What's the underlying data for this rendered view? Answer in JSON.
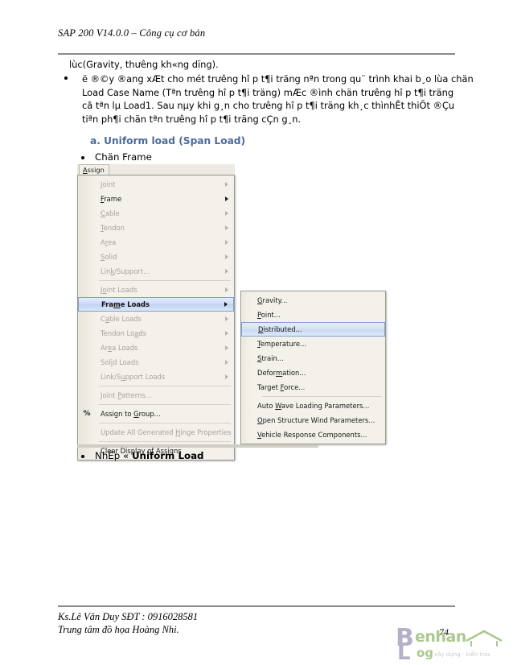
{
  "document": {
    "header_title": "SAP 200 V14.0.0 – Công cụ cơ bản",
    "lead_line": "lùc(Gravity, thưêng kh«ng dïng).",
    "paragraph": {
      "line1": "ë ®©y ®ang xÆt cho mét trưêng hî p t¶i träng nªn trong qu¨ trình khai b¸o lùa chän",
      "line2": "Load Case Name (Tªn trưêng hî p t¶i träng) mÆc ®ình chän trưêng hî p t¶i träng",
      "line3": "cã tªn lµ Load1. Sau nµy khi g¸n cho trưêng hî p t¶i träng kh¸c thìnhÊt thiÕt ®Çu",
      "line4": "tiªn ph¶i chän tªn trưêng hî p t¶i träng cÇn g¸n."
    },
    "sub_heading": "a. Uniform load (Span Load)",
    "steps": {
      "step1": "Chän Frame",
      "step2_prefix": "NhËp « ",
      "step2_bold": "Uniform Load"
    },
    "footer": {
      "line1": "Ks.Lê Văn Duy SĐT : 0916028581",
      "line2": "Trung tâm đồ họa Hoàng Nhi.",
      "page_number": "74"
    },
    "watermark": {
      "b": "B",
      "l": "L",
      "enhan": "enhan",
      "og": "og",
      "tagline": "xây dựng - kiến trúc",
      "house_icon": "house-icon"
    }
  },
  "sap_menu": {
    "menubar_item": "Assign",
    "menubar_accel": "A",
    "items": [
      {
        "label": "Joint",
        "accel": "J",
        "enabled": false,
        "submenu": true,
        "selected": false,
        "separator_after": false
      },
      {
        "label": "Frame",
        "accel": "F",
        "enabled": true,
        "submenu": true,
        "selected": false,
        "separator_after": false
      },
      {
        "label": "Cable",
        "accel": "C",
        "enabled": false,
        "submenu": true,
        "selected": false,
        "separator_after": false
      },
      {
        "label": "Tendon",
        "accel": "T",
        "enabled": false,
        "submenu": true,
        "selected": false,
        "separator_after": false
      },
      {
        "label": "Area",
        "accel": "r",
        "enabled": false,
        "submenu": true,
        "selected": false,
        "separator_after": false
      },
      {
        "label": "Solid",
        "accel": "S",
        "enabled": false,
        "submenu": true,
        "selected": false,
        "separator_after": false
      },
      {
        "label": "Link/Support...",
        "accel": "k",
        "enabled": false,
        "submenu": true,
        "selected": false,
        "separator_after": true
      },
      {
        "label": "Joint Loads",
        "accel": "o",
        "enabled": false,
        "submenu": true,
        "selected": false,
        "separator_after": false
      },
      {
        "label": "Frame Loads",
        "accel": "m",
        "enabled": true,
        "submenu": true,
        "selected": true,
        "separator_after": false
      },
      {
        "label": "Cable Loads",
        "accel": "a",
        "enabled": false,
        "submenu": true,
        "selected": false,
        "separator_after": false
      },
      {
        "label": "Tendon Loads",
        "accel": "a",
        "enabled": false,
        "submenu": true,
        "selected": false,
        "separator_after": false
      },
      {
        "label": "Area Loads",
        "accel": "e",
        "enabled": false,
        "submenu": true,
        "selected": false,
        "separator_after": false
      },
      {
        "label": "Solid Loads",
        "accel": "i",
        "enabled": false,
        "submenu": true,
        "selected": false,
        "separator_after": false
      },
      {
        "label": "Link/Support Loads",
        "accel": "u",
        "enabled": false,
        "submenu": true,
        "selected": false,
        "separator_after": true
      },
      {
        "label": "Joint Patterns...",
        "accel": "P",
        "enabled": false,
        "submenu": false,
        "selected": false,
        "separator_after": true
      },
      {
        "label": "Assign to Group...",
        "accel": "G",
        "enabled": true,
        "submenu": false,
        "selected": false,
        "separator_after": true,
        "icon": "percent-group-icon"
      },
      {
        "label": "Update All Generated Hinge Properties",
        "accel": "H",
        "enabled": false,
        "submenu": false,
        "selected": false,
        "separator_after": true
      },
      {
        "label": "Clear Display of Assigns",
        "accel": "y",
        "enabled": true,
        "submenu": false,
        "selected": false,
        "separator_after": false
      }
    ],
    "submenu_title": "Frame Loads",
    "submenu_items": [
      {
        "label": "Gravity...",
        "accel": "G",
        "selected": false,
        "separator_after": false
      },
      {
        "label": "Point...",
        "accel": "P",
        "selected": false,
        "separator_after": false
      },
      {
        "label": "Distributed...",
        "accel": "D",
        "selected": true,
        "separator_after": false
      },
      {
        "label": "Temperature...",
        "accel": "T",
        "selected": false,
        "separator_after": false
      },
      {
        "label": "Strain...",
        "accel": "S",
        "selected": false,
        "separator_after": false
      },
      {
        "label": "Deformation...",
        "accel": "m",
        "selected": false,
        "separator_after": false
      },
      {
        "label": "Target Force...",
        "accel": "F",
        "selected": false,
        "separator_after": true
      },
      {
        "label": "Auto Wave Loading Parameters...",
        "accel": "W",
        "selected": false,
        "separator_after": false
      },
      {
        "label": "Open Structure Wind Parameters...",
        "accel": "O",
        "selected": false,
        "separator_after": false
      },
      {
        "label": "Vehicle Response Components...",
        "accel": "V",
        "selected": false,
        "separator_after": false
      }
    ]
  },
  "colors": {
    "heading_blue": "#4c6b9a",
    "rule_gray": "#888a8c",
    "menu_face": "#f3f1ea",
    "menu_border": "#9a978d",
    "selection_border": "#7ea0cf",
    "disabled_text": "#a8a399",
    "logo_purple": "#8b7fa8",
    "logo_green": "#7aa84a"
  }
}
